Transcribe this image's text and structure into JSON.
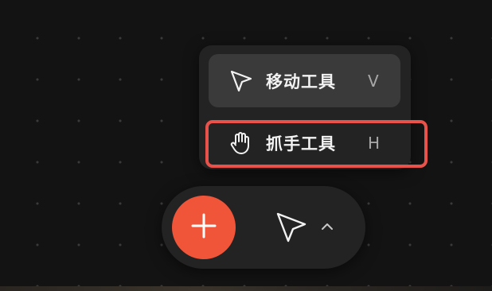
{
  "tool_menu": {
    "items": [
      {
        "icon": "pointer-arrow-icon",
        "label": "移动工具",
        "shortcut": "V",
        "selected": true
      },
      {
        "icon": "hand-icon",
        "label": "抓手工具",
        "shortcut": "H",
        "selected": false
      }
    ]
  },
  "toolbar": {
    "add_icon": "plus-icon",
    "current_tool_icon": "pointer-arrow-icon",
    "expand_icon": "chevron-up-icon"
  },
  "colors": {
    "canvas_background": "#131313",
    "panel_background": "#232323",
    "selected_item_background": "#3a3a3a",
    "accent": "#f0553a",
    "highlight_outline": "#e8524a"
  }
}
